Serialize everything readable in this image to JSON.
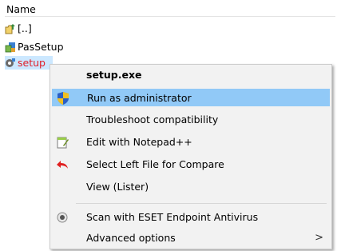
{
  "panel": {
    "column_header": "Name",
    "files": [
      {
        "name": "[..]",
        "icon": "up-folder-icon"
      },
      {
        "name": "PasSetup",
        "icon": "installer-icon"
      },
      {
        "name": "setup",
        "icon": "setup-gear-icon"
      }
    ]
  },
  "menu": {
    "items": [
      {
        "label": "setup.exe",
        "bold": true
      },
      {
        "label": "Run as administrator",
        "icon": "uac-shield-icon",
        "highlighted": true
      },
      {
        "label": "Troubleshoot compatibility"
      },
      {
        "label": "Edit with Notepad++",
        "icon": "notepad-plus-plus-icon"
      },
      {
        "label": "Select Left File for Compare",
        "icon": "compare-arrow-icon"
      },
      {
        "label": "View (Lister)"
      },
      {
        "label": "Scan with ESET Endpoint Antivirus",
        "icon": "eset-scan-icon"
      },
      {
        "label": "Advanced options",
        "submenu_arrow": ">"
      }
    ]
  },
  "colors": {
    "selection": "#cce8ff",
    "highlight": "#91c9f7",
    "selected_filename": "#e0202a"
  }
}
